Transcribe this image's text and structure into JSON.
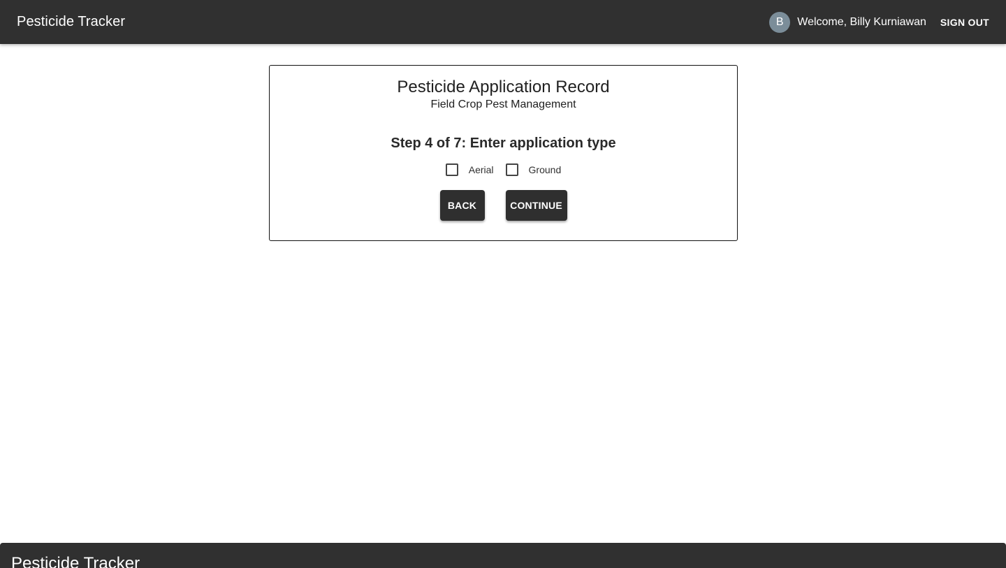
{
  "header": {
    "app_title": "Pesticide Tracker",
    "avatar_initial": "B",
    "welcome_text": "Welcome, Billy Kurniawan",
    "sign_out_label": "SIGN OUT"
  },
  "record": {
    "title": "Pesticide Application Record",
    "subtitle": "Field Crop Pest Management",
    "step_heading": "Step 4 of 7: Enter application type",
    "options": [
      {
        "label": "Aerial",
        "checked": false
      },
      {
        "label": "Ground",
        "checked": false
      }
    ],
    "back_label": "BACK",
    "continue_label": "CONTINUE"
  },
  "footer": {
    "app_title": "Pesticide Tracker"
  },
  "colors": {
    "app_bar": "#303030",
    "button": "#2f2f2f",
    "avatar": "#7b8d99"
  }
}
